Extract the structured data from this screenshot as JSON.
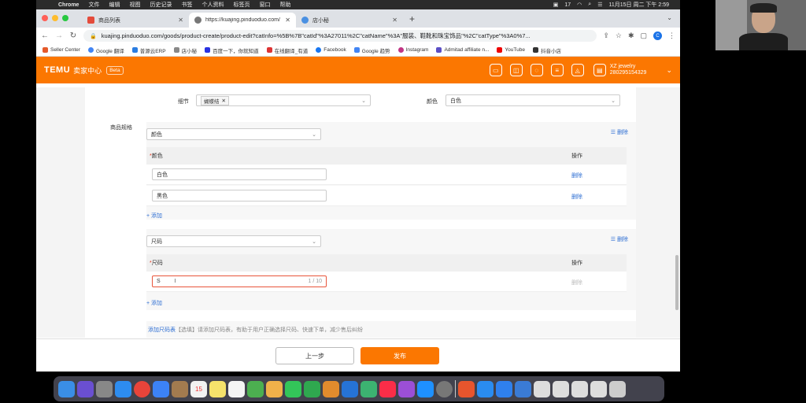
{
  "menubar": {
    "app": "Chrome",
    "items": [
      "文件",
      "编辑",
      "视图",
      "历史记录",
      "书签",
      "个人资料",
      "标签页",
      "窗口",
      "帮助"
    ],
    "status": [
      "17",
      "11月15日 周二 下午 2:59"
    ]
  },
  "tabs": [
    {
      "label": "商品列表",
      "color": "#e44b3b"
    },
    {
      "label": "https://kuajing.pinduoduo.com/",
      "color": "#777"
    },
    {
      "label": "店小秘",
      "color": "#4a90e2"
    }
  ],
  "address": {
    "url": "kuajing.pinduoduo.com/goods/product-create/product-edit?catInfo=%5B%7B\"catId\"%3A27011%2C\"catName\"%3A\"服装、鞋靴和珠宝饰品\"%2C\"catType\"%3A0%7...",
    "profile_initial": "C"
  },
  "bookmarks": [
    {
      "label": "Seller Center",
      "color": "#e55a2b"
    },
    {
      "label": "Google 翻译",
      "color": "#4285f4"
    },
    {
      "label": "普源云ERP",
      "color": "#2a7de1"
    },
    {
      "label": "店小秘",
      "color": "#888"
    },
    {
      "label": "百度一下，你就知道",
      "color": "#2932e1"
    },
    {
      "label": "在线翻译_有道",
      "color": "#d33"
    },
    {
      "label": "Facebook",
      "color": "#1877f2"
    },
    {
      "label": "Google 趋势",
      "color": "#4285f4"
    },
    {
      "label": "Instagram",
      "color": "#c13584"
    },
    {
      "label": "Admitad affiliate n...",
      "color": "#5b4fc6"
    },
    {
      "label": "YouTube",
      "color": "#e00"
    },
    {
      "label": "抖音小店",
      "color": "#333"
    }
  ],
  "temu": {
    "logo": "TEMU",
    "center": "卖家中心",
    "badge": "Beta",
    "store_name": "XZ jewelry",
    "store_id": "280295154329"
  },
  "form": {
    "detail_label": "细节",
    "detail_tag": "蝴蝶结",
    "color_label": "颜色",
    "color_value": "白色",
    "spec_label": "商品规格",
    "delete": "删除",
    "add": "+ 添加",
    "operation": "操作",
    "spec1": {
      "select": "颜色",
      "header": "颜色",
      "rows": [
        "白色",
        "黑色"
      ]
    },
    "spec2": {
      "select": "尺码",
      "header": "尺码",
      "input_value": "S",
      "counter": "1 / 10"
    },
    "size_chart_link": "添加尺码表",
    "size_chart_hint": "【选填】请添加尺码表，有助于用户正确选择尺码、快速下单，减少售后纠纷"
  },
  "footer": {
    "prev": "上一步",
    "publish": "发布"
  },
  "colors": {
    "temu_orange": "#fb7701",
    "link_blue": "#2f6fd3",
    "required_red": "#e5341d"
  }
}
